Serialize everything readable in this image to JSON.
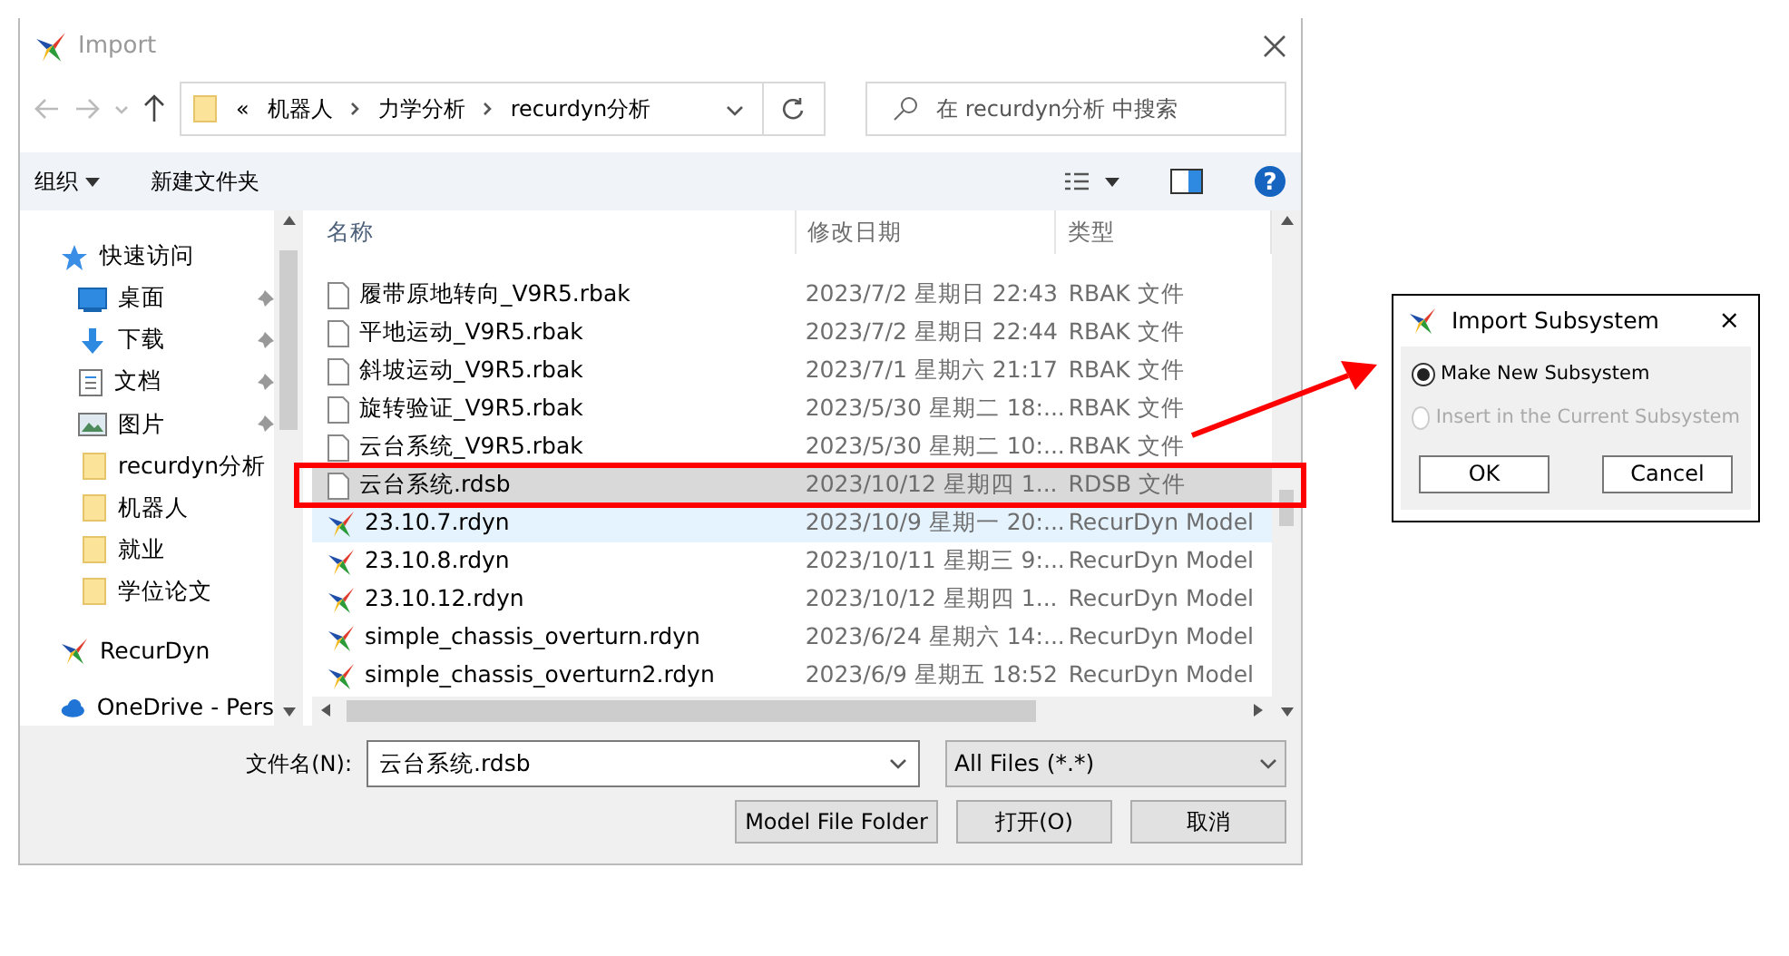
{
  "window": {
    "title": "Import"
  },
  "address_bar": {
    "path": [
      {
        "label": "«"
      },
      {
        "label": "机器人"
      },
      {
        "label": "力学分析"
      },
      {
        "label": "recurdyn分析"
      }
    ]
  },
  "search": {
    "placeholder": "在 recurdyn分析 中搜索"
  },
  "toolbar": {
    "organize": "组织",
    "new_folder": "新建文件夹",
    "help": "?"
  },
  "sidebar": {
    "items": [
      {
        "label": "快速访问",
        "kind": "star",
        "pinned": false
      },
      {
        "label": "桌面",
        "kind": "desktop",
        "pinned": true
      },
      {
        "label": "下载",
        "kind": "download",
        "pinned": true
      },
      {
        "label": "文档",
        "kind": "document",
        "pinned": true
      },
      {
        "label": "图片",
        "kind": "picture",
        "pinned": true
      },
      {
        "label": "recurdyn分析",
        "kind": "folder",
        "pinned": false
      },
      {
        "label": "机器人",
        "kind": "folder",
        "pinned": false
      },
      {
        "label": "就业",
        "kind": "folder",
        "pinned": false
      },
      {
        "label": "学位论文",
        "kind": "folder",
        "pinned": false
      },
      {
        "label": "RecurDyn",
        "kind": "app",
        "pinned": false
      },
      {
        "label": "OneDrive - Pers",
        "kind": "cloud",
        "pinned": false
      }
    ]
  },
  "file_list": {
    "columns": [
      "名称",
      "修改日期",
      "类型"
    ],
    "rows": [
      {
        "name": "履带原地转向_V9R5.rbak",
        "date": "2023/7/2 星期日 22:43",
        "type": "RBAK 文件",
        "kind": "file",
        "selected": false,
        "hovered": false
      },
      {
        "name": "平地运动_V9R5.rbak",
        "date": "2023/7/2 星期日 22:44",
        "type": "RBAK 文件",
        "kind": "file",
        "selected": false,
        "hovered": false
      },
      {
        "name": "斜坡运动_V9R5.rbak",
        "date": "2023/7/1 星期六 21:17",
        "type": "RBAK 文件",
        "kind": "file",
        "selected": false,
        "hovered": false
      },
      {
        "name": "旋转验证_V9R5.rbak",
        "date": "2023/5/30 星期二 18:...",
        "type": "RBAK 文件",
        "kind": "file",
        "selected": false,
        "hovered": false
      },
      {
        "name": "云台系统_V9R5.rbak",
        "date": "2023/5/30 星期二 10:...",
        "type": "RBAK 文件",
        "kind": "file",
        "selected": false,
        "hovered": false
      },
      {
        "name": "云台系统.rdsb",
        "date": "2023/10/12 星期四 1...",
        "type": "RDSB 文件",
        "kind": "file",
        "selected": true,
        "hovered": false
      },
      {
        "name": "23.10.7.rdyn",
        "date": "2023/10/9 星期一 20:...",
        "type": "RecurDyn Model",
        "kind": "model",
        "selected": false,
        "hovered": true
      },
      {
        "name": "23.10.8.rdyn",
        "date": "2023/10/11 星期三 9:...",
        "type": "RecurDyn Model",
        "kind": "model",
        "selected": false,
        "hovered": false
      },
      {
        "name": "23.10.12.rdyn",
        "date": "2023/10/12 星期四 1...",
        "type": "RecurDyn Model",
        "kind": "model",
        "selected": false,
        "hovered": false
      },
      {
        "name": "simple_chassis_overturn.rdyn",
        "date": "2023/6/24 星期六 14:...",
        "type": "RecurDyn Model",
        "kind": "model",
        "selected": false,
        "hovered": false
      },
      {
        "name": "simple_chassis_overturn2.rdyn",
        "date": "2023/6/9 星期五 18:52",
        "type": "RecurDyn Model",
        "kind": "model",
        "selected": false,
        "hovered": false
      }
    ]
  },
  "footer": {
    "filename_label": "文件名(N):",
    "filename": "云台系统.rdsb",
    "filter": "All Files (*.*)",
    "buttons": [
      "Model File Folder",
      "打开(O)",
      "取消"
    ]
  },
  "subsystem_dialog": {
    "title": "Import Subsystem",
    "close": "×",
    "options": [
      {
        "label": "Make New Subsystem",
        "selected": true,
        "disabled": false
      },
      {
        "label": "Insert in the Current Subsystem",
        "selected": false,
        "disabled": true
      }
    ],
    "buttons": [
      "OK",
      "Cancel"
    ]
  }
}
